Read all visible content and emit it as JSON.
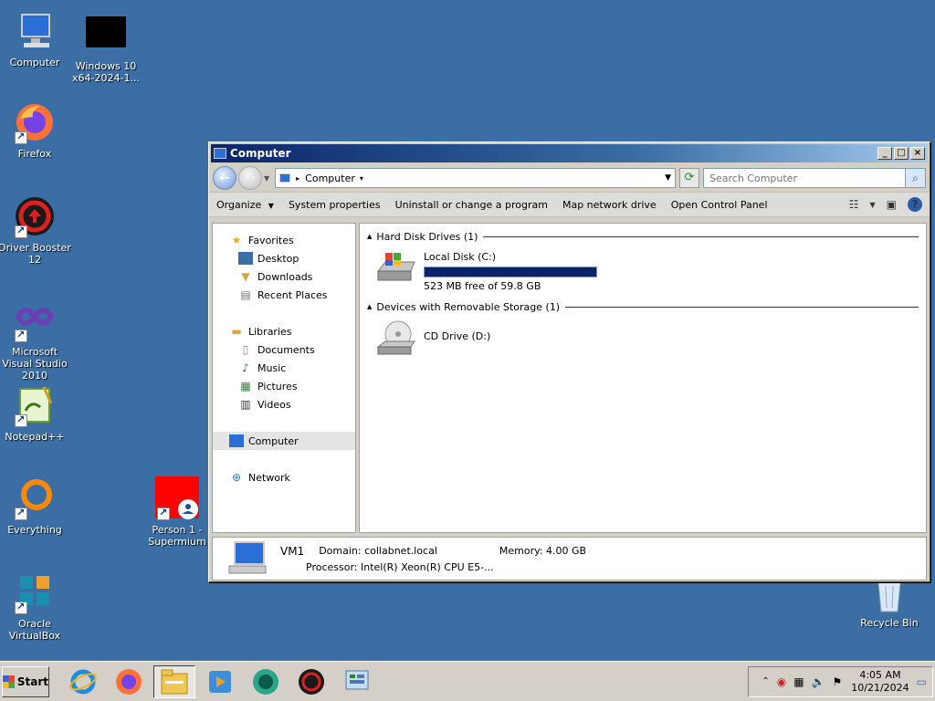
{
  "desktop": {
    "icons": [
      {
        "label": "Computer"
      },
      {
        "label": "Windows 10 x64-2024-1..."
      },
      {
        "label": "Firefox"
      },
      {
        "label": "Driver Booster 12"
      },
      {
        "label": "Microsoft Visual Studio 2010"
      },
      {
        "label": "Notepad++"
      },
      {
        "label": "Everything"
      },
      {
        "label": "Person 1 - Supermium"
      },
      {
        "label": "Oracle VirtualBox"
      },
      {
        "label": "Recycle Bin"
      }
    ]
  },
  "window": {
    "title": "Computer",
    "minimize": "_",
    "maximize": "□",
    "close": "×",
    "address": {
      "segment": "Computer"
    },
    "search": {
      "placeholder": "Search Computer"
    },
    "commands": [
      {
        "label": "Organize"
      },
      {
        "label": "System properties"
      },
      {
        "label": "Uninstall or change a program"
      },
      {
        "label": "Map network drive"
      },
      {
        "label": "Open Control Panel"
      }
    ],
    "help_label": "?",
    "nav": {
      "favorites": "Favorites",
      "desktop": "Desktop",
      "downloads": "Downloads",
      "recent": "Recent Places",
      "libraries": "Libraries",
      "documents": "Documents",
      "music": "Music",
      "pictures": "Pictures",
      "videos": "Videos",
      "computer": "Computer",
      "network": "Network"
    },
    "groups": {
      "hdd": "Hard Disk Drives (1)",
      "removable": "Devices with Removable Storage (1)"
    },
    "drives": {
      "c": {
        "name": "Local Disk (C:)",
        "free": "523 MB free of 59.8 GB",
        "used_fraction": 0.991
      },
      "d": {
        "name": "CD Drive (D:)"
      }
    },
    "details": {
      "name": "VM1",
      "domain_label": "Domain:",
      "domain": "collabnet.local",
      "memory_label": "Memory:",
      "memory": "4.00 GB",
      "processor_label": "Processor:",
      "processor": "Intel(R) Xeon(R) CPU E5-..."
    }
  },
  "taskbar": {
    "start": "Start",
    "clock_time": "4:05 AM",
    "clock_date": "10/21/2024"
  }
}
